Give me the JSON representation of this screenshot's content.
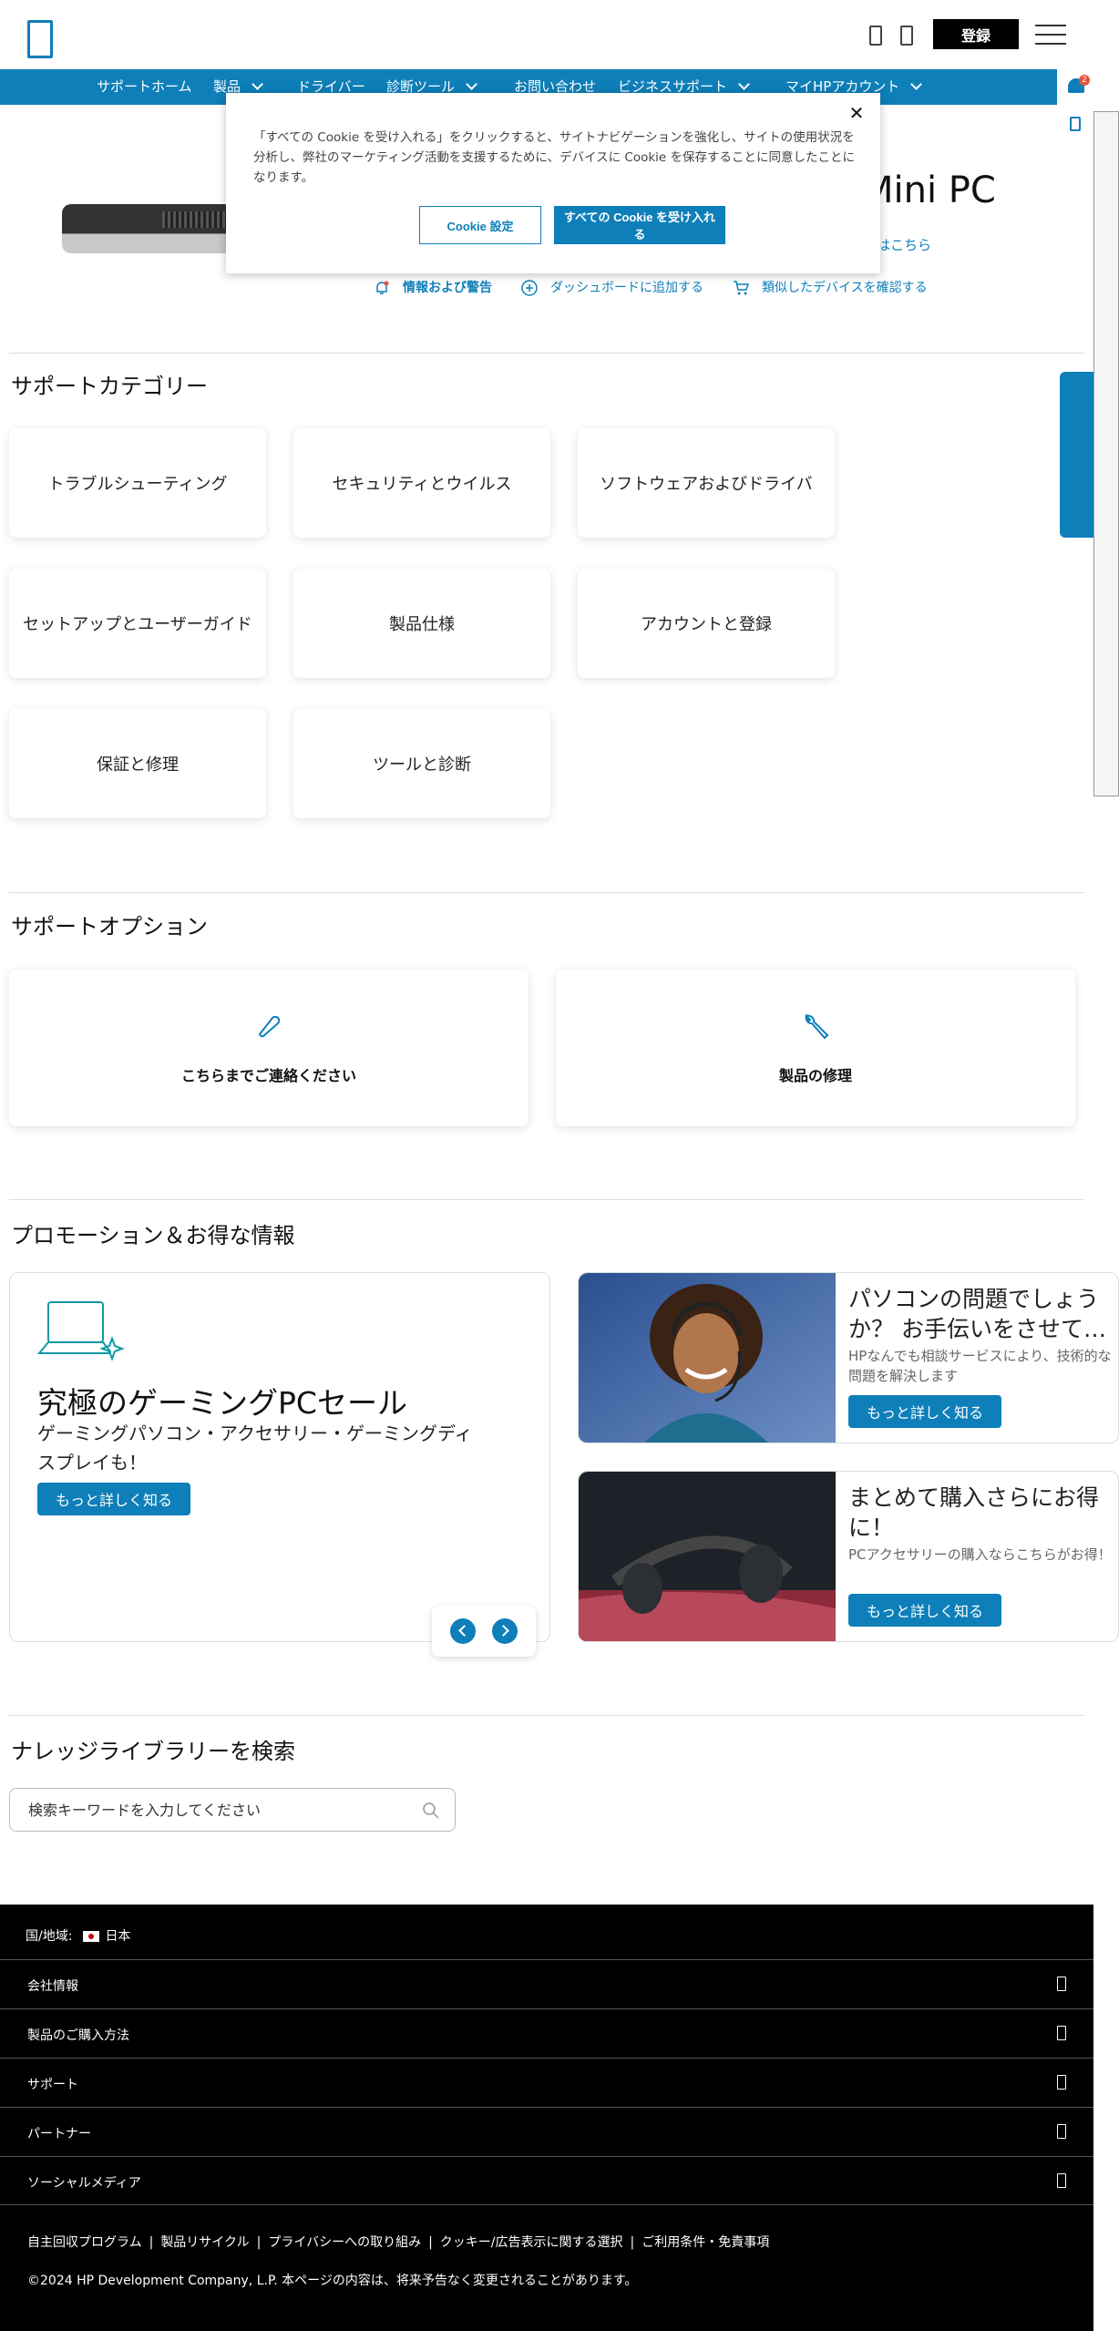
{
  "header": {
    "login_label": "登録"
  },
  "nav": {
    "items": [
      {
        "label": "サポートホーム",
        "dropdown": false
      },
      {
        "label": "製品",
        "dropdown": true
      },
      {
        "label": "ドライバー",
        "dropdown": false
      },
      {
        "label": "診断ツール",
        "dropdown": true
      },
      {
        "label": "お問い合わせ",
        "dropdown": false
      },
      {
        "label": "ビジネスサポート",
        "dropdown": true
      },
      {
        "label": "マイHPアカウント",
        "dropdown": true
      }
    ]
  },
  "notifications": {
    "badge_count": "2"
  },
  "cookie": {
    "text": "「すべての Cookie を受け入れる」をクリックすると、サイトナビゲーションを強化し、サイトの使用状況を分析し、弊社のマーケティング活動を支援するために、デバイスに Cookie を保存することに同意したことになります。",
    "settings_label": "Cookie 設定",
    "accept_label": "すべての Cookie を受け入れる",
    "close_symbol": "✕"
  },
  "product": {
    "title_visible": "Mini PC",
    "link_visible": "はこちら",
    "actions": [
      {
        "label": "情報および警告",
        "icon": "bell-icon"
      },
      {
        "label": "ダッシュボードに追加する",
        "icon": "plus-circle-icon"
      },
      {
        "label": "類似したデバイスを確認する",
        "icon": "cart-icon"
      }
    ]
  },
  "support_categories": {
    "title": "サポートカテゴリー",
    "items": [
      "トラブルシューティング",
      "セキュリティとウイルス",
      "ソフトウェアおよびドライバ",
      "セットアップとユーザーガイド",
      "製品仕様",
      "アカウントと登録",
      "保証と修理",
      "ツールと診断"
    ]
  },
  "support_options": {
    "title": "サポートオプション",
    "items": [
      {
        "label": "こちらまでご連絡ください",
        "icon": "phone-icon"
      },
      {
        "label": "製品の修理",
        "icon": "wrench-icon"
      }
    ]
  },
  "promotions": {
    "title": "プロモーション＆お得な情報",
    "main": {
      "heading": "究極のゲーミングPCセール",
      "subtext": "ゲーミングパソコン・アクセサリー・ゲーミングディスプレイも！",
      "button": "もっと詳しく知る"
    },
    "cards": [
      {
        "heading": "パソコンの問題でしょうか？ お手伝いをさせて…",
        "text": "HPなんでも相談サービスにより、技術的な問題を解決します",
        "button": "もっと詳しく知る"
      },
      {
        "heading": "まとめて購入さらにお得に！",
        "text": "PCアクセサリーの購入ならこちらがお得！",
        "button": "もっと詳しく知る"
      }
    ]
  },
  "knowledge": {
    "title": "ナレッジライブラリーを検索",
    "placeholder": "検索キーワードを入力してください"
  },
  "footer": {
    "region_label": "国/地域:",
    "region_value": "日本",
    "sections": [
      "会社情報",
      "製品のご購入方法",
      "サポート",
      "パートナー",
      "ソーシャルメディア"
    ],
    "links": [
      "自主回収プログラム",
      "製品リサイクル",
      "プライバシーへの取り組み",
      "クッキー/広告表示に関する選択",
      "ご利用条件・免責事項"
    ],
    "link_separator": "|",
    "copyright": "©2024 HP Development Company, L.P. 本ページの内容は、将来予告なく変更されることがあります。"
  },
  "colors": {
    "brand_blue": "#0e7fb9",
    "footer_bg": "#000000",
    "badge_red": "#e8523f"
  }
}
